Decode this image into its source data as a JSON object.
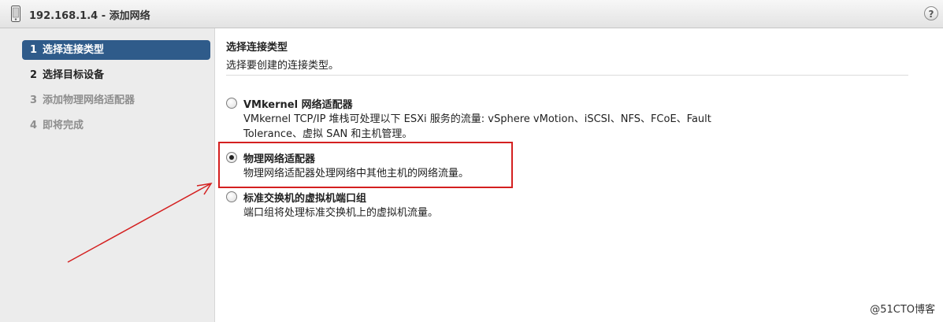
{
  "window": {
    "title": "192.168.1.4 - 添加网络",
    "device_icon": "device-icon",
    "help_label": "?"
  },
  "steps": [
    {
      "num": "1",
      "label": "选择连接类型",
      "state": "active"
    },
    {
      "num": "2",
      "label": "选择目标设备",
      "state": "normal"
    },
    {
      "num": "3",
      "label": "添加物理网络适配器",
      "state": "disabled"
    },
    {
      "num": "4",
      "label": "即将完成",
      "state": "disabled"
    }
  ],
  "content": {
    "title": "选择连接类型",
    "description": "选择要创建的连接类型。",
    "options": [
      {
        "label": "VMkernel 网络适配器",
        "desc_line1": "VMkernel TCP/IP 堆栈可处理以下 ESXi 服务的流量: vSphere vMotion、iSCSI、NFS、FCoE、Fault",
        "desc_line2": "Tolerance、虚拟 SAN 和主机管理。",
        "selected": false
      },
      {
        "label": "物理网络适配器",
        "desc_line1": "物理网络适配器处理网络中其他主机的网络流量。",
        "selected": true
      },
      {
        "label": "标准交换机的虚拟机端口组",
        "desc_line1": "端口组将处理标准交换机上的虚拟机流量。",
        "selected": false
      }
    ]
  },
  "annotation": {
    "color": "#d42020"
  },
  "watermark": "@51CTO博客"
}
